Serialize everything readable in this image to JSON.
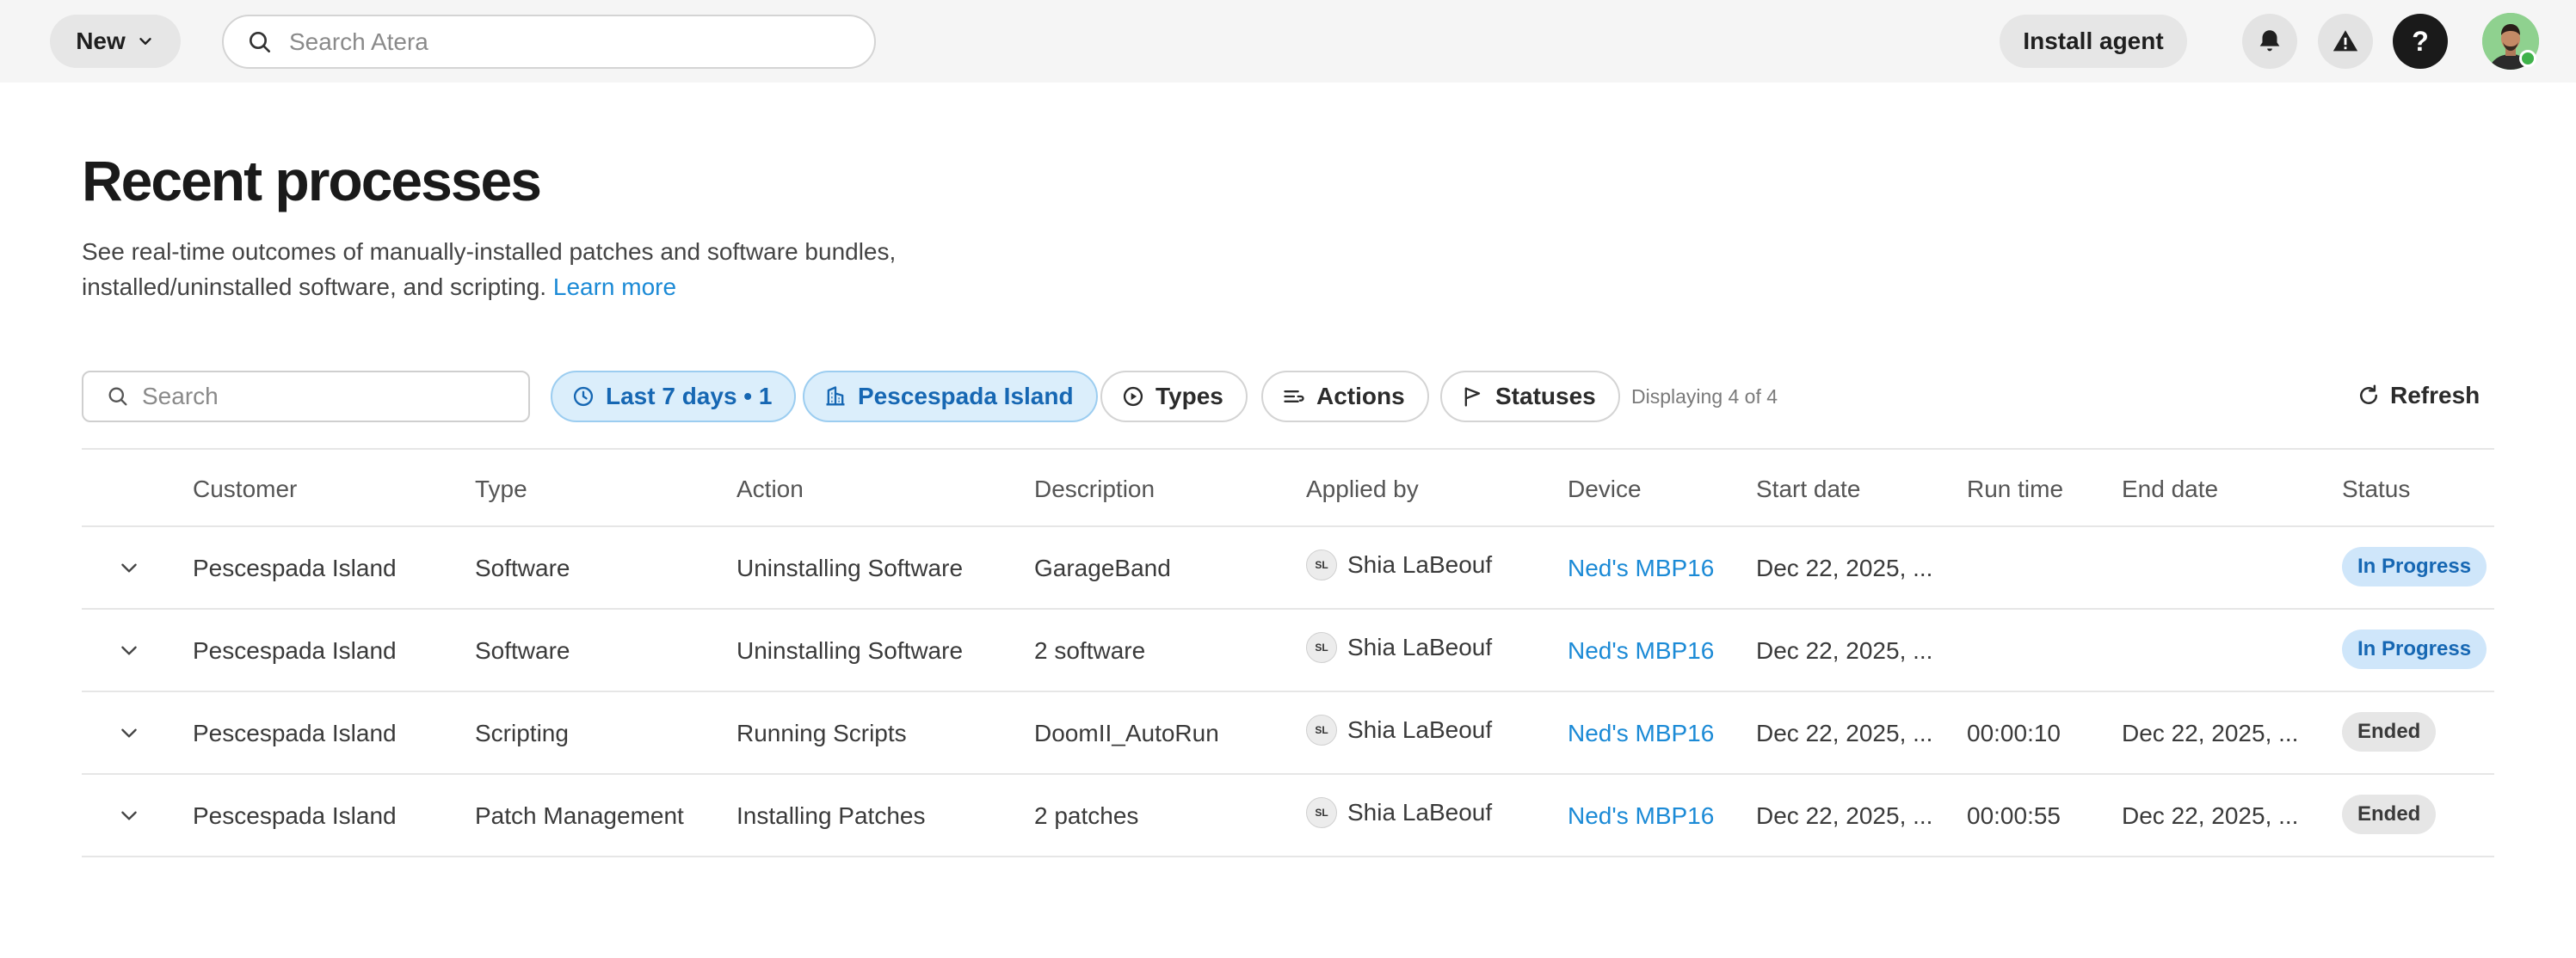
{
  "topbar": {
    "new_label": "New",
    "search_placeholder": "Search Atera",
    "install_agent_label": "Install agent",
    "help_label": "?"
  },
  "page": {
    "title": "Recent processes",
    "description": "See real-time outcomes of manually-installed patches and software bundles, installed/uninstalled software, and scripting.",
    "learn_more": "Learn more"
  },
  "filters": {
    "search_placeholder": "Search",
    "date_chip": "Last 7 days • 1",
    "customer_chip": "Pescespada Island",
    "types_chip": "Types",
    "actions_chip": "Actions",
    "statuses_chip": "Statuses",
    "displaying": "Displaying 4 of 4",
    "refresh_label": "Refresh"
  },
  "table": {
    "columns": [
      "Customer",
      "Type",
      "Action",
      "Description",
      "Applied by",
      "Device",
      "Start date",
      "Run time",
      "End date",
      "Status"
    ],
    "rows": [
      {
        "customer": "Pescespada Island",
        "type": "Software",
        "action": "Uninstalling Software",
        "description": "GarageBand",
        "initials": "SL",
        "applied_by": "Shia LaBeouf",
        "device": "Ned's MBP16",
        "start_date": "Dec 22, 2025, ...",
        "run_time": "",
        "end_date": "",
        "status": "In Progress"
      },
      {
        "customer": "Pescespada Island",
        "type": "Software",
        "action": "Uninstalling Software",
        "description": "2 software",
        "initials": "SL",
        "applied_by": "Shia LaBeouf",
        "device": "Ned's MBP16",
        "start_date": "Dec 22, 2025, ...",
        "run_time": "",
        "end_date": "",
        "status": "In Progress"
      },
      {
        "customer": "Pescespada Island",
        "type": "Scripting",
        "action": "Running Scripts",
        "description": "DoomII_AutoRun",
        "initials": "SL",
        "applied_by": "Shia LaBeouf",
        "device": "Ned's MBP16",
        "start_date": "Dec 22, 2025, ...",
        "run_time": "00:00:10",
        "end_date": "Dec 22, 2025, ...",
        "status": "Ended"
      },
      {
        "customer": "Pescespada Island",
        "type": "Patch Management",
        "action": "Installing Patches",
        "description": "2 patches",
        "initials": "SL",
        "applied_by": "Shia LaBeouf",
        "device": "Ned's MBP16",
        "start_date": "Dec 22, 2025, ...",
        "run_time": "00:00:55",
        "end_date": "Dec 22, 2025, ...",
        "status": "Ended"
      }
    ]
  },
  "colors": {
    "link": "#1b8ad6",
    "chip_active_bg": "#dbeefb",
    "status_in_progress_bg": "#cfe6fa",
    "status_ended_bg": "#e6e6e6",
    "online_dot": "#3fb24a"
  }
}
